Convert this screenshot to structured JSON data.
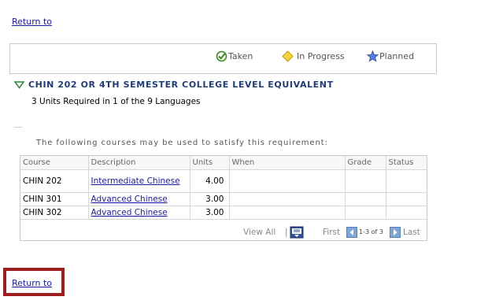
{
  "nav": {
    "return_top": "Return to",
    "return_bottom": "Return to"
  },
  "legend": {
    "taken": "Taken",
    "in_progress": "In Progress",
    "planned": "Planned",
    "taken_icon": "check-circle-icon",
    "in_progress_icon": "diamond-icon",
    "planned_icon": "star-icon",
    "colors": {
      "taken": "#3a8a1c",
      "in_progress": "#e3b81a",
      "planned": "#3b5fc4"
    }
  },
  "requirement": {
    "title": "CHIN 202 OR 4TH SEMESTER COLLEGE LEVEL EQUIVALENT",
    "subtitle": "3 Units Required in 1 of the 9 Languages"
  },
  "courses": {
    "caption": "The following courses may be used to satisfy this requirement:",
    "headers": [
      "Course",
      "Description",
      "Units",
      "When",
      "Grade",
      "Status"
    ],
    "rows": [
      {
        "course": "CHIN 202",
        "description": "Intermediate Chinese",
        "units": "4.00",
        "when": "",
        "grade": "",
        "status": ""
      },
      {
        "course": "CHIN 301",
        "description": "Advanced Chinese",
        "units": "3.00",
        "when": "",
        "grade": "",
        "status": ""
      },
      {
        "course": "CHIN 302",
        "description": "Advanced Chinese",
        "units": "3.00",
        "when": "",
        "grade": "",
        "status": ""
      }
    ],
    "pager": {
      "view_all": "View All",
      "separator": "|",
      "first": "First",
      "count": "1-3 of 3",
      "last": "Last"
    }
  },
  "accent_color": "#a11c1c"
}
